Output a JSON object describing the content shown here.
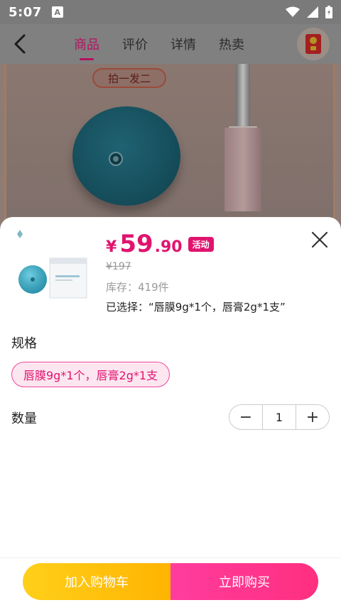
{
  "status_bar": {
    "time": "5:07",
    "notif_letter": "A"
  },
  "header": {
    "tabs": [
      {
        "label": "商品",
        "active": true
      },
      {
        "label": "评价",
        "active": false
      },
      {
        "label": "详情",
        "active": false
      },
      {
        "label": "热卖",
        "active": false
      }
    ]
  },
  "hero": {
    "promo_text": "拍一发二"
  },
  "sheet": {
    "price_symbol": "¥",
    "price_int": "59",
    "price_dec": ".90",
    "activity_badge": "活动",
    "old_price": "¥197",
    "stock_text": "库存：419件",
    "selected_text": "已选择：“唇膜9g*1个，唇膏2g*1支”",
    "spec_label": "规格",
    "spec_option": "唇膜9g*1个，唇膏2g*1支",
    "qty_label": "数量",
    "qty_minus": "−",
    "qty_value": "1",
    "qty_plus": "+"
  },
  "actions": {
    "add_to_cart": "加入购物车",
    "buy_now": "立即购买"
  },
  "colors": {
    "accent": "#e0146e",
    "cart_btn": "#ffbe0a",
    "buy_btn": "#ff3590"
  }
}
